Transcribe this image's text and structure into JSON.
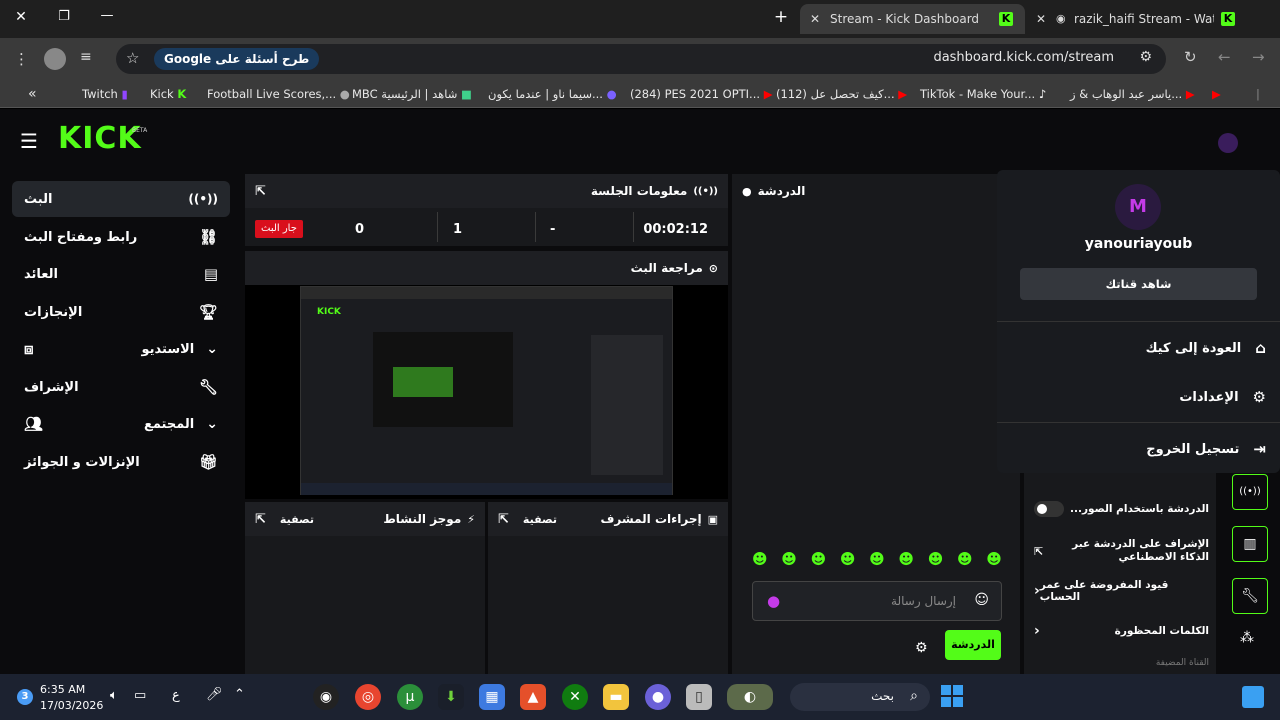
{
  "browser": {
    "tabs": [
      {
        "label": "Stream - Kick Dashboard",
        "active": true
      },
      {
        "label": "razik_haifi Stream - Watch L",
        "active": false
      }
    ],
    "window_controls": {
      "close": "✕",
      "restore": "❐",
      "minimize": "—",
      "new_tab": "+"
    },
    "google_chip": "Google طرح أسئلة على",
    "url": "dashboard.kick.com/stream",
    "bookmarks": [
      {
        "label": "Twitch"
      },
      {
        "label": "Kick"
      },
      {
        "label": "Football Live Scores,..."
      },
      {
        "label": "MBC شاهد | الرئيسية"
      },
      {
        "label": "سيما ناو | عندما يكون..."
      },
      {
        "label": "(284) PES 2021 OPTI..."
      },
      {
        "label": "(112) كيف تحصل عل..."
      },
      {
        "label": "TikTok - Make Your..."
      },
      {
        "label": "ياسر عبد الوهاب & ز..."
      }
    ],
    "bookmarks_collapse": "«"
  },
  "app": {
    "logo": "KICK",
    "logo_badge": "BETA",
    "sidebar": [
      {
        "label": "البث",
        "active": true
      },
      {
        "label": "رابط ومفتاح البث"
      },
      {
        "label": "العائد"
      },
      {
        "label": "الإنجازات"
      },
      {
        "label": "الاستديو"
      },
      {
        "label": "الإشراف"
      },
      {
        "label": "المجتمع"
      },
      {
        "label": "الإنزالات و الجوائز"
      }
    ],
    "session": {
      "title": "معلومات الجلسة",
      "live_badge": "جار البث",
      "stats": [
        "0",
        "1",
        "-",
        "00:02:12"
      ]
    },
    "preview": {
      "title": "مراجعة البث"
    },
    "activity": {
      "title": "موجز النشاط",
      "filter": "تصفية"
    },
    "mod_actions": {
      "title": "إجراءات المشرف",
      "filter": "تصفية"
    },
    "chat": {
      "title": "الدردشة",
      "placeholder": "إرسال رسالة",
      "send_label": "الدردشة"
    },
    "settings_panel": {
      "rows": [
        {
          "label": "...الدردشة باستخدام الصور"
        },
        {
          "label": "الإشراف على الدردشة عبر الذكاء الاصطناعي"
        },
        {
          "label": "قيود المفروضة على عمر الحساب"
        },
        {
          "label": "الكلمات المحظورة"
        }
      ],
      "footer": "القناة المضيفة"
    },
    "user_menu": {
      "username": "yanouriayoub",
      "watch_button": "شاهد قناتك",
      "items": [
        {
          "label": "العودة إلى كيك"
        },
        {
          "label": "الإعدادات"
        },
        {
          "label": "تسجيل الخروج"
        }
      ]
    }
  },
  "taskbar": {
    "time": "6:35 AM",
    "date": "17/03/2026",
    "lang": "ع",
    "search_label": "بحث",
    "notification_count": "3"
  },
  "colors": {
    "kick_green": "#53fc18",
    "live_red": "#d90f1c"
  }
}
